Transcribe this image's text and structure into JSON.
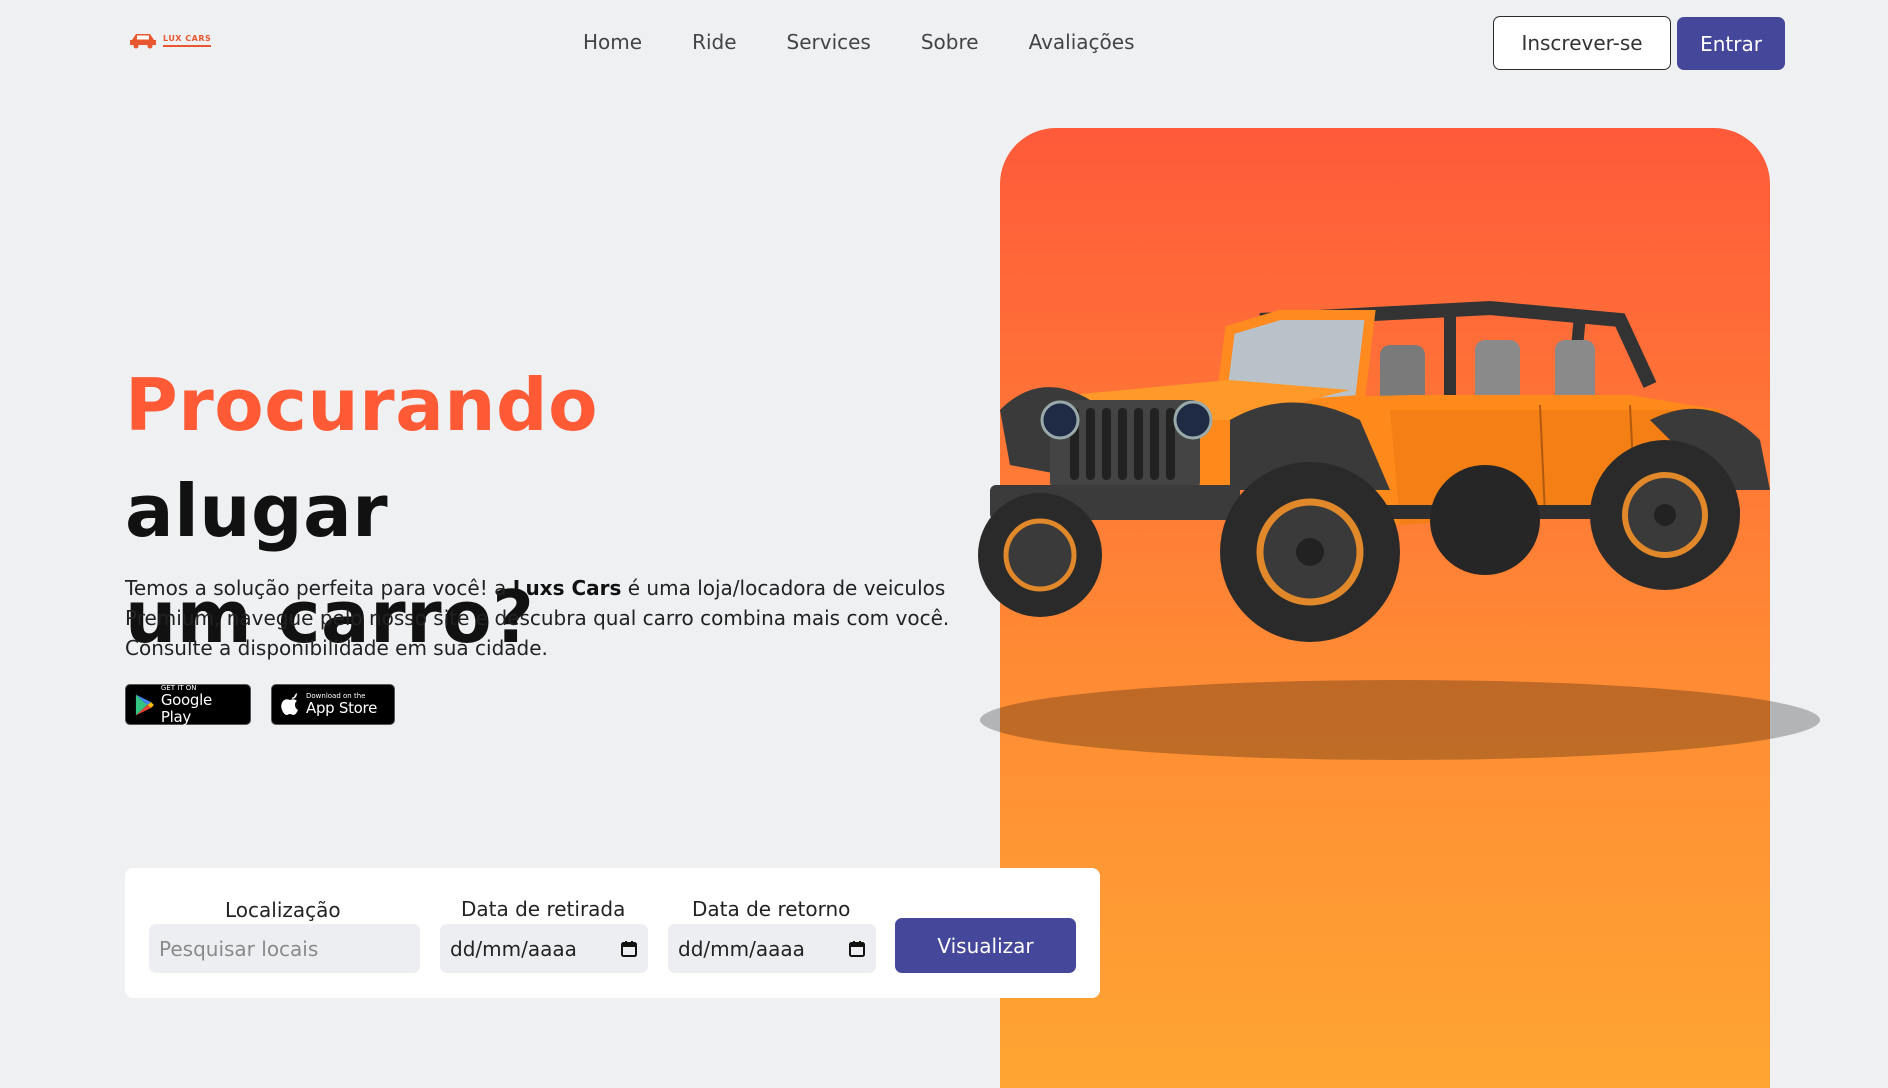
{
  "brand": {
    "logo_text": "LUX CARS",
    "accent": "#ff5a36",
    "primary": "#45479a"
  },
  "nav": {
    "items": [
      {
        "label": "Home"
      },
      {
        "label": "Ride"
      },
      {
        "label": "Services"
      },
      {
        "label": "Sobre"
      },
      {
        "label": "Avaliações"
      }
    ]
  },
  "auth": {
    "signup_label": "Inscrever-se",
    "login_label": "Entrar"
  },
  "hero": {
    "headline_accent": "Procurando",
    "headline_rest_1": "alugar",
    "headline_rest_2": "um carro?",
    "lead_1": "Temos a solução perfeita para você! a ",
    "lead_brand": "Luxs Cars",
    "lead_2": " é uma loja/locadora de veiculos Premium, navegue pelo nosso site e descubra qual carro combina mais com você. Consulte a disponibilidade em sua cidade."
  },
  "stores": {
    "google": {
      "small": "GET IT ON",
      "big": "Google Play"
    },
    "apple": {
      "small": "Download on the",
      "big": "App Store"
    }
  },
  "search": {
    "location_label": "Localização",
    "location_placeholder": "Pesquisar locais",
    "pickup_label": "Data de retirada",
    "pickup_value": "dd/mm/aaaa",
    "return_label": "Data de retorno",
    "return_value": "dd/mm/aaaa",
    "submit_label": "Visualizar"
  },
  "icons": {
    "logo": "car-logo-icon",
    "google_play": "google-play-icon",
    "apple": "apple-icon",
    "calendar": "calendar-icon",
    "hero_image": "orange-jeep-image"
  }
}
